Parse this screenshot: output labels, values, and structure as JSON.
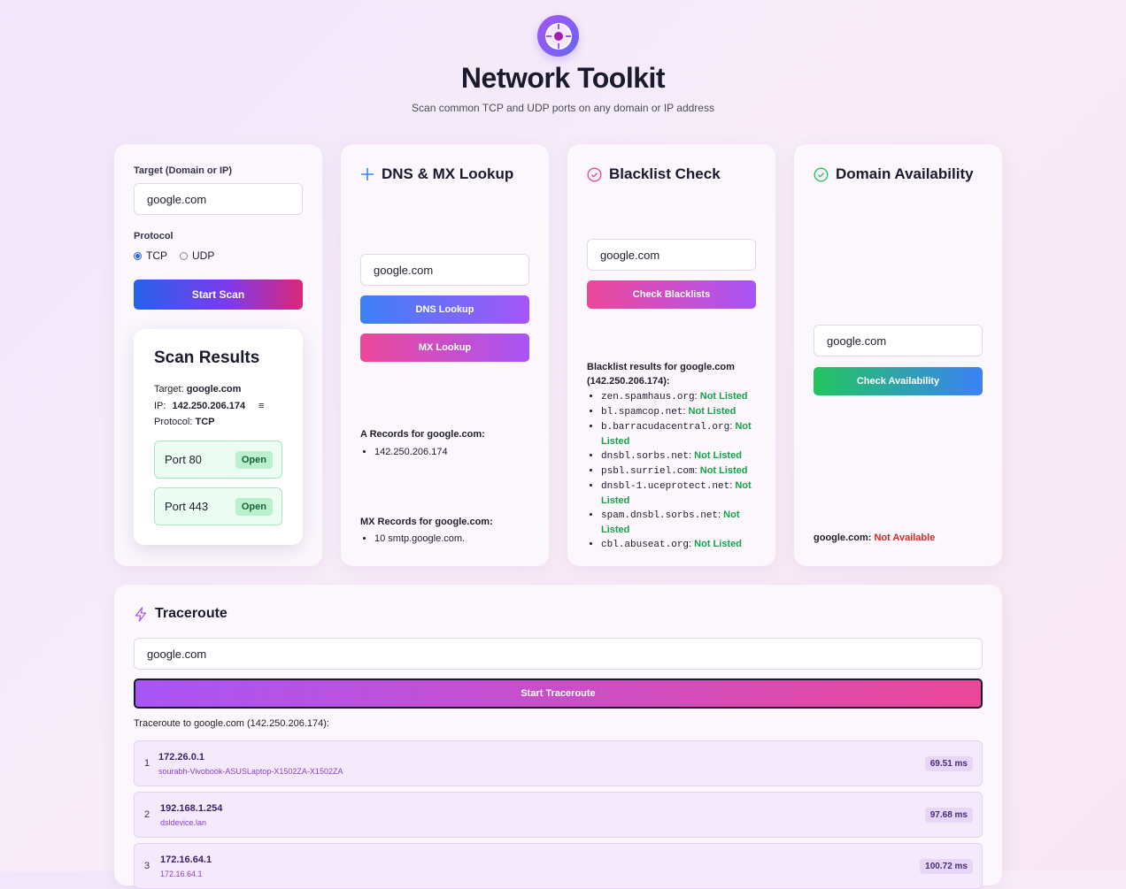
{
  "header": {
    "title": "Network Toolkit",
    "subtitle": "Scan common TCP and UDP ports on any domain or IP address",
    "logo_icon": "target-icon"
  },
  "scanner": {
    "target_label": "Target (Domain or IP)",
    "target_value": "google.com",
    "protocol_label": "Protocol",
    "protocol_options": [
      "TCP",
      "UDP"
    ],
    "protocol_selected": "TCP",
    "start_button": "Start Scan",
    "results": {
      "title": "Scan Results",
      "target_label": "Target:",
      "target_value": "google.com",
      "ip_label": "IP:",
      "ip_value": "142.250.206.174",
      "ip_menu_icon": "≡",
      "protocol_label": "Protocol:",
      "protocol_value": "TCP",
      "ports": [
        {
          "label": "Port 80",
          "status": "Open"
        },
        {
          "label": "Port 443",
          "status": "Open"
        }
      ]
    }
  },
  "dns": {
    "title": "DNS & MX Lookup",
    "icon": "plus-icon",
    "input_value": "google.com",
    "dns_button": "DNS Lookup",
    "mx_button": "MX Lookup",
    "a_records_label": "A Records for google.com:",
    "a_records": [
      "142.250.206.174"
    ],
    "mx_records_label": "MX Records for google.com:",
    "mx_records": [
      "10 smtp.google.com."
    ]
  },
  "blacklist": {
    "title": "Blacklist Check",
    "icon": "check-circle-icon",
    "input_value": "google.com",
    "button": "Check Blacklists",
    "results_label": "Blacklist results for google.com (142.250.206.174):",
    "results": [
      {
        "server": "zen.spamhaus.org",
        "status": "Not Listed"
      },
      {
        "server": "bl.spamcop.net",
        "status": "Not Listed"
      },
      {
        "server": "b.barracudacentral.org",
        "status": "Not Listed"
      },
      {
        "server": "dnsbl.sorbs.net",
        "status": "Not Listed"
      },
      {
        "server": "psbl.surriel.com",
        "status": "Not Listed"
      },
      {
        "server": "dnsbl-1.uceprotect.net",
        "status": "Not Listed"
      },
      {
        "server": "spam.dnsbl.sorbs.net",
        "status": "Not Listed"
      },
      {
        "server": "cbl.abuseat.org",
        "status": "Not Listed"
      }
    ]
  },
  "availability": {
    "title": "Domain Availability",
    "icon": "check-circle-icon",
    "input_value": "google.com",
    "button": "Check Availability",
    "result_domain": "google.com:",
    "result_status": "Not Available"
  },
  "traceroute": {
    "title": "Traceroute",
    "icon": "bolt-icon",
    "input_value": "google.com",
    "button": "Start Traceroute",
    "result_label": "Traceroute to google.com (142.250.206.174):",
    "hops": [
      {
        "num": "1",
        "ip": "172.26.0.1",
        "host": "sourabh-Vivobook-ASUSLaptop-X1502ZA-X1502ZA",
        "ms": "69.51 ms"
      },
      {
        "num": "2",
        "ip": "192.168.1.254",
        "host": "dsldevice.lan",
        "ms": "97.68 ms"
      },
      {
        "num": "3",
        "ip": "172.16.64.1",
        "host": "172.16.64.1",
        "ms": "100.72 ms"
      }
    ]
  },
  "colors": {
    "accent_purple": "#a855f7",
    "accent_pink": "#ec4899",
    "accent_blue": "#3b82f6",
    "accent_green": "#22c55e",
    "ok_green": "#16a34a",
    "bad_red": "#dc2626"
  }
}
